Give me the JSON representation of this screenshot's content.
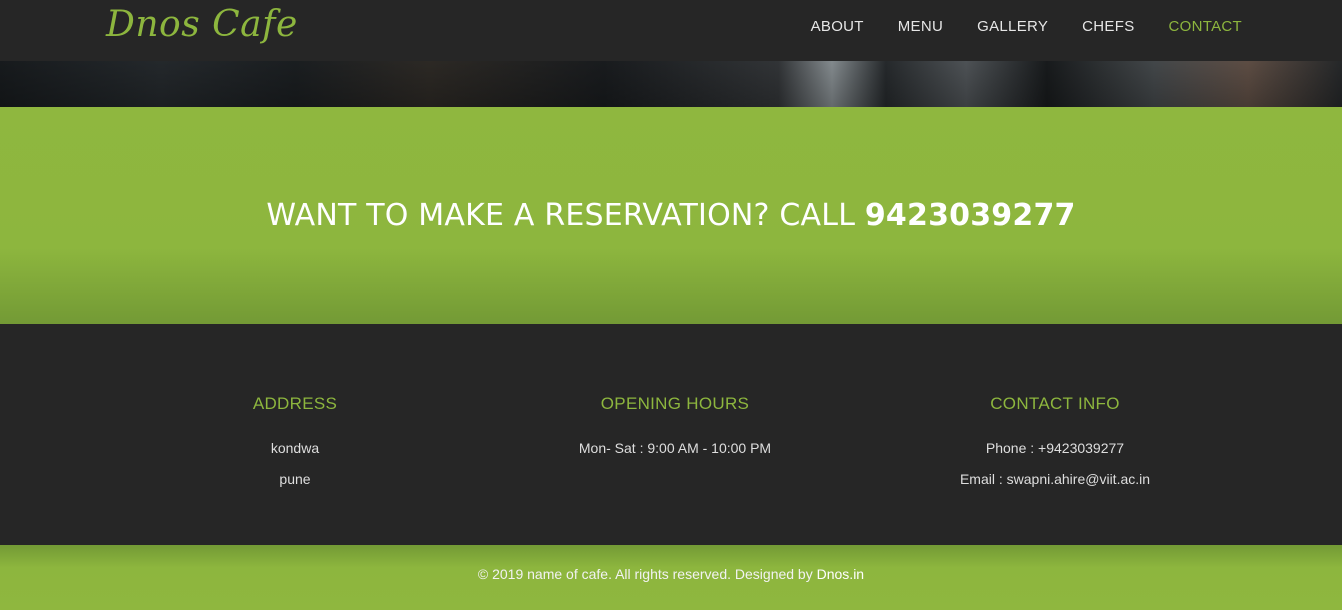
{
  "navbar": {
    "brand": "Dnos Cafe",
    "links": [
      "ABOUT",
      "MENU",
      "GALLERY",
      "CHEFS",
      "CONTACT"
    ],
    "active": "CONTACT"
  },
  "reservation": {
    "text": "WANT TO MAKE A RESERVATION? CALL",
    "phone": "9423039277"
  },
  "info": {
    "address": {
      "title": "ADDRESS",
      "lines": [
        "kondwa",
        "pune"
      ]
    },
    "hours": {
      "title": "OPENING HOURS",
      "lines": [
        "Mon- Sat : 9:00 AM - 10:00 PM"
      ]
    },
    "contact": {
      "title": "CONTACT INFO",
      "lines": [
        "Phone : +9423039277",
        "Email : swapni.ahire@viit.ac.in"
      ]
    }
  },
  "footer": {
    "text": "© 2019 name of cafe. All rights reserved. Designed by",
    "link": "Dnos.in"
  },
  "colors": {
    "accent": "#8db63e",
    "dark_bg": "#262626"
  }
}
